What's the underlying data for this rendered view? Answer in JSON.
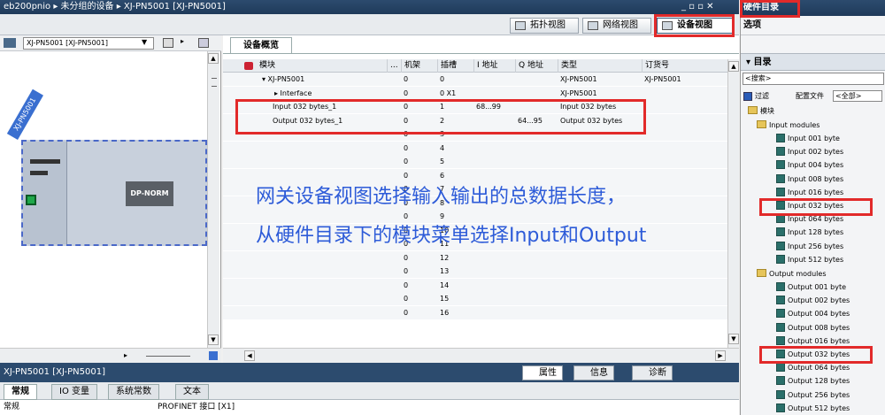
{
  "titlebar": {
    "breadcrumb": "eb200pnio ▸ 未分组的设备 ▸ XJ-PN5001 [XJ-PN5001]",
    "controls": "_ ▫ ▫ ✕"
  },
  "views": {
    "topology": "拓扑视图",
    "network": "网络视图",
    "device": "设备视图"
  },
  "left": {
    "device_select": "XJ-PN5001 [XJ-PN5001]",
    "device_tag": "XJ-PN5001",
    "module_label": "DP-NORM"
  },
  "overview": {
    "tab": "设备概览",
    "headers": [
      "模块",
      "...",
      "机架",
      "插槽",
      "I 地址",
      "Q 地址",
      "类型",
      "订货号"
    ],
    "rows": [
      [
        "▾ XJ-PN5001",
        "0",
        "0",
        "",
        "",
        "XJ-PN5001",
        "XJ-PN5001"
      ],
      [
        "▸ Interface",
        "0",
        "0 X1",
        "",
        "",
        "XJ-PN5001",
        ""
      ],
      [
        "Input 032 bytes_1",
        "0",
        "1",
        "68...99",
        "",
        "Input 032 bytes",
        ""
      ],
      [
        "Output 032 bytes_1",
        "0",
        "2",
        "",
        "64...95",
        "Output 032 bytes",
        ""
      ],
      [
        "",
        "0",
        "3",
        "",
        "",
        "",
        ""
      ],
      [
        "",
        "0",
        "4",
        "",
        "",
        "",
        ""
      ],
      [
        "",
        "0",
        "5",
        "",
        "",
        "",
        ""
      ],
      [
        "",
        "0",
        "6",
        "",
        "",
        "",
        ""
      ],
      [
        "",
        "0",
        "7",
        "",
        "",
        "",
        ""
      ],
      [
        "",
        "0",
        "8",
        "",
        "",
        "",
        ""
      ],
      [
        "",
        "0",
        "9",
        "",
        "",
        "",
        ""
      ],
      [
        "",
        "0",
        "10",
        "",
        "",
        "",
        ""
      ],
      [
        "",
        "0",
        "11",
        "",
        "",
        "",
        ""
      ],
      [
        "",
        "0",
        "12",
        "",
        "",
        "",
        ""
      ],
      [
        "",
        "0",
        "13",
        "",
        "",
        "",
        ""
      ],
      [
        "",
        "0",
        "14",
        "",
        "",
        "",
        ""
      ],
      [
        "",
        "0",
        "15",
        "",
        "",
        "",
        ""
      ],
      [
        "",
        "0",
        "16",
        "",
        "",
        "",
        ""
      ]
    ]
  },
  "annotation": {
    "line1": "网关设备视图选择输入输出的总数据长度，",
    "line2": "从硬件目录下的模块菜单选择Input和Output"
  },
  "sidebar": {
    "title": "硬件目录",
    "options": "选项",
    "catalog": "目录",
    "search": "<搜索>",
    "filter": "过滤",
    "profile_label": "配置文件",
    "profile_value": "<全部>",
    "module_folder": "模块",
    "input_folder": "Input modules",
    "output_folder": "Output modules",
    "input_items": [
      "Input 001 byte",
      "Input 002 bytes",
      "Input 004 bytes",
      "Input 008 bytes",
      "Input 016 bytes",
      "Input 032 bytes",
      "Input 064 bytes",
      "Input 128 bytes",
      "Input 256 bytes",
      "Input 512 bytes"
    ],
    "output_items": [
      "Output 001 byte",
      "Output 002 bytes",
      "Output 004 bytes",
      "Output 008 bytes",
      "Output 016 bytes",
      "Output 032 bytes",
      "Output 064 bytes",
      "Output 128 bytes",
      "Output 256 bytes",
      "Output 512 bytes"
    ]
  },
  "props": {
    "title": "XJ-PN5001 [XJ-PN5001]",
    "prop_tab": "属性",
    "info_tab": "信息",
    "diag_tab": "诊断",
    "tabs": [
      "常规",
      "IO 变量",
      "系统常数",
      "文本"
    ],
    "section": "常规",
    "profinet": "PROFINET 接口 [X1]"
  }
}
